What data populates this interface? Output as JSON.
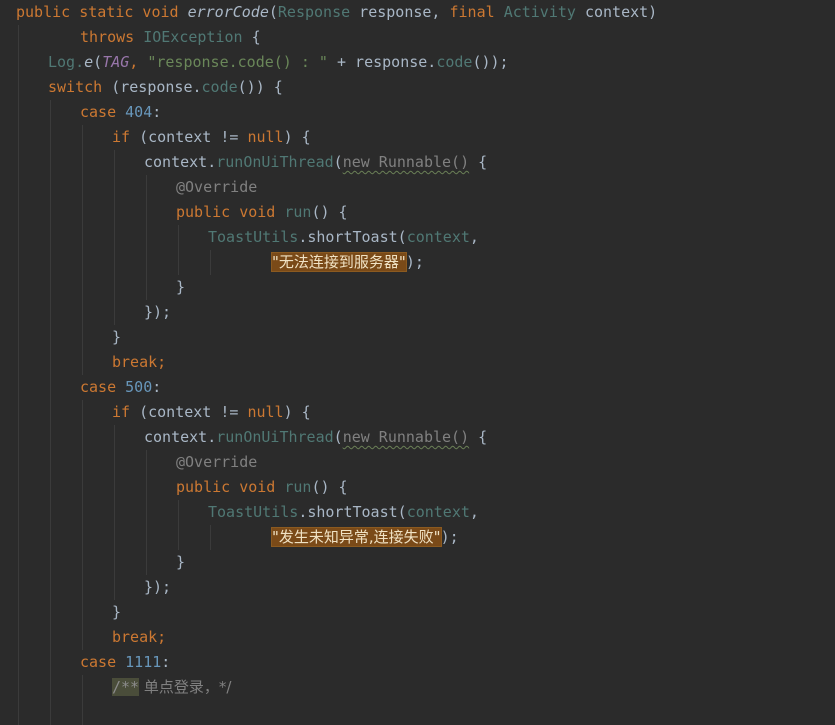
{
  "editor": {
    "colors": {
      "background": "#2b2b2b",
      "keyword": "#cc7832",
      "string": "#6a8759",
      "number": "#6897bb",
      "annotation": "#bbb529",
      "field": "#9876aa",
      "comment": "#808080",
      "string_highlight": "#7a4a18"
    },
    "l1": {
      "a": "public static void ",
      "b": "errorCode",
      "c": "(",
      "d": "Response",
      "e": " response, ",
      "f": "final ",
      "g": "Activity",
      "h": " context)"
    },
    "l2": {
      "a": "throws ",
      "b": "IOException",
      "c": " {"
    },
    "l3": {
      "a": "Log.",
      "b": "e",
      "c": "(",
      "d": "TAG",
      "e": ", ",
      "f": "\"response.code() : \"",
      "g": " + response.",
      "h": "code",
      "i": "());"
    },
    "l4": {
      "a": "switch ",
      "b": "(response.",
      "c": "code",
      "d": "()) {"
    },
    "l5": {
      "a": "case ",
      "b": "404",
      "c": ":"
    },
    "l6": {
      "a": "if ",
      "b": "(context != ",
      "c": "null",
      "d": ") {"
    },
    "l7": {
      "a": "context.",
      "b": "runOnUiThread",
      "c": "(",
      "d": "new Runnable()",
      "e": " {"
    },
    "l8": {
      "a": "@Override"
    },
    "l9": {
      "a": "public void ",
      "b": "run",
      "c": "() {"
    },
    "l10": {
      "a": "ToastUtils",
      "b": ".shortToast(",
      "c": "context",
      "d": ","
    },
    "l11": {
      "a": "\"无法连接到服务器\"",
      "b": ");"
    },
    "l12": {
      "a": "}"
    },
    "l13": {
      "a": "});"
    },
    "l14": {
      "a": "}"
    },
    "l15": {
      "a": "break",
      "b": ";"
    },
    "l16": {
      "a": "case ",
      "b": "500",
      "c": ":"
    },
    "l17": {
      "a": "if ",
      "b": "(context != ",
      "c": "null",
      "d": ") {"
    },
    "l18": {
      "a": "context.",
      "b": "runOnUiThread",
      "c": "(",
      "d": "new Runnable()",
      "e": " {"
    },
    "l19": {
      "a": "@Override"
    },
    "l20": {
      "a": "public void ",
      "b": "run",
      "c": "() {"
    },
    "l21": {
      "a": "ToastUtils",
      "b": ".shortToast(",
      "c": "context",
      "d": ","
    },
    "l22": {
      "a": "\"发生未知异常,连接失败\"",
      "b": ");"
    },
    "l23": {
      "a": "}"
    },
    "l24": {
      "a": "});"
    },
    "l25": {
      "a": "}"
    },
    "l26": {
      "a": "break",
      "b": ";"
    },
    "l27": {
      "a": "case ",
      "b": "1111",
      "c": ":"
    },
    "l28": {
      "a": "/**",
      "b": " 单点登录，*/"
    }
  }
}
